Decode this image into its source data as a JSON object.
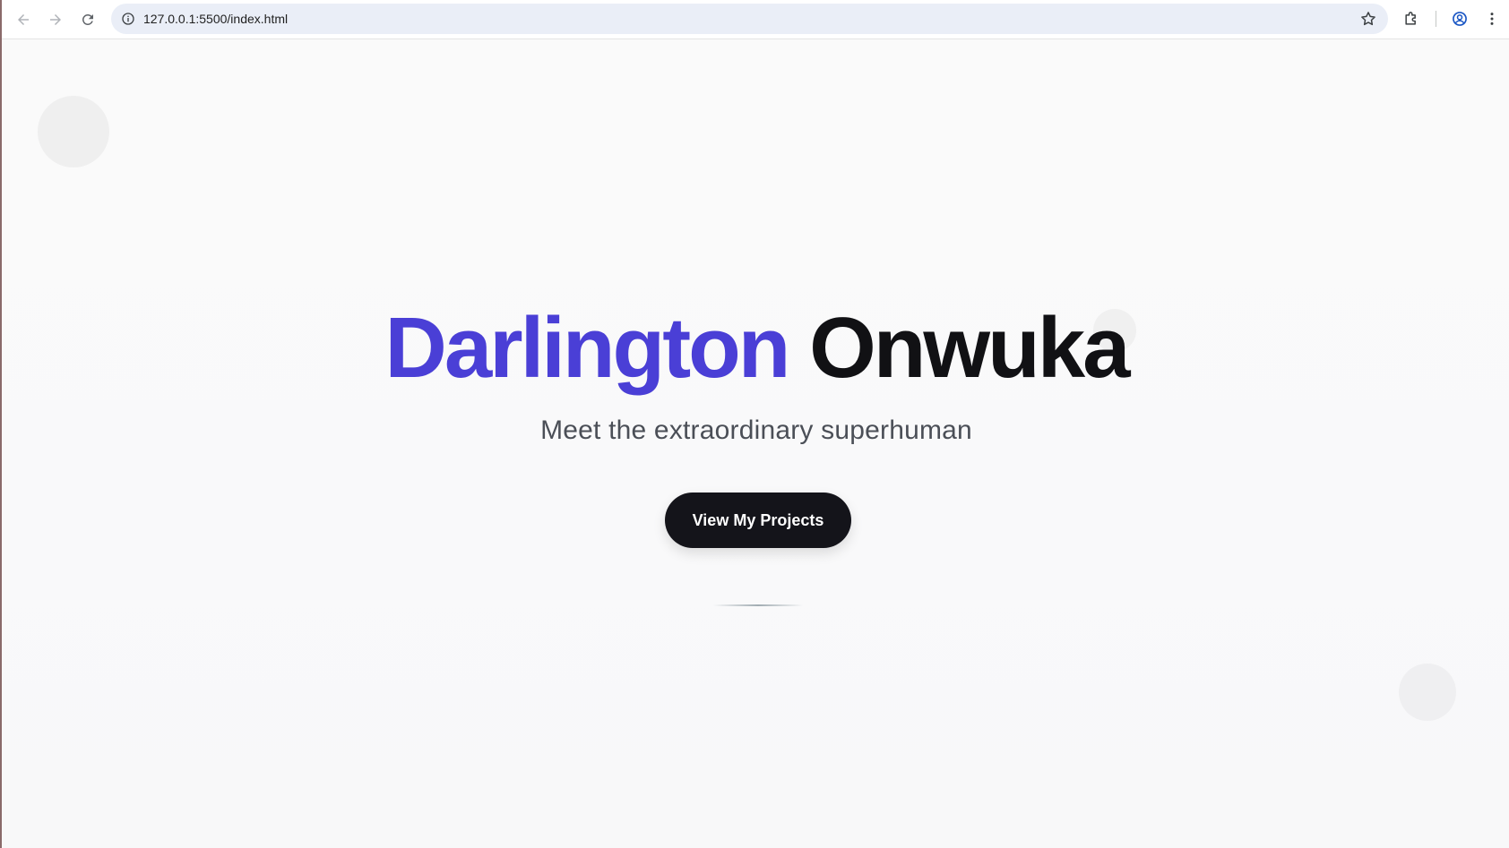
{
  "browser": {
    "url": "127.0.0.1:5500/index.html"
  },
  "hero": {
    "first_name": "Darlington",
    "last_name": "Onwuka",
    "subtitle": "Meet the extraordinary superhuman",
    "cta_label": "View My Projects"
  },
  "colors": {
    "accent": "#4a3fd6",
    "title_dark": "#111114",
    "button_bg": "#14141a",
    "subtitle": "#4b4f57",
    "omnibox_bg": "#eaeef7"
  },
  "icons": {
    "back": "arrow-left-icon",
    "forward": "arrow-right-icon",
    "reload": "reload-icon",
    "site_info": "info-icon",
    "bookmark": "star-icon",
    "extensions": "puzzle-icon",
    "profile": "account-circle-icon",
    "menu": "kebab-menu-icon"
  }
}
